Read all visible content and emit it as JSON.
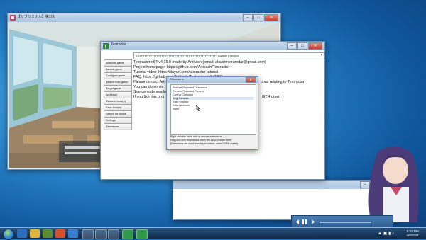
{
  "game_window": {
    "title": "[【サブリミナル】第1話]"
  },
  "textractor": {
    "title": "Textractor",
    "process_select": "0:0-FFFFFFFFFFFFFFFF:FFFFFFFFFFFFFFFF:FFFFFFFFFFFFFFFF) Console (HB0@0)",
    "buttons": [
      "Attach to game",
      "Launch game",
      "Configure game",
      "Detach from game",
      "Forget game",
      "Add hook",
      "Remove hook(s)",
      "Save hook(s)",
      "Search for hooks",
      "Settings",
      "Extensions"
    ],
    "lines": [
      "Textractor x64 v4.16.0 made by Artikash (email: akashmozumdar@gmail.com)",
      "Project homepage: https://github.com/Artikash/Textractor",
      "Tutorial video: https://tinyurl.com/textractor-tutorial",
      "FAQ: https://github.com/Artikash/Textractor/wiki/FAQ",
      "Please contact Arti",
      "You can do so via",
      "Source code availa",
      "If you like this proj"
    ],
    "line_tails": [
      "tions relating to Textractor",
      "GTH down :)"
    ]
  },
  "extensions_dialog": {
    "title": "Extensions",
    "items": [
      "Remove Repeated Characters",
      "Remove Repeated Phrases",
      "Copy to Clipboard",
      "Bing Translate",
      "Extra Window",
      "Extra Newlines",
      "Styler"
    ],
    "help": [
      "Right click the list to add or remove extensions",
      "Drag and drop extensions within the list to reorder them",
      "(Extensions are used from top to bottom: order DOES matter)"
    ]
  },
  "taskbar": {
    "clock_time": "5:52 PM",
    "clock_date": "4/8/2021",
    "tray": "▲ ▣ ▮ ♪"
  },
  "colors": {
    "desktop": "#1d6fb8",
    "titlebar": "#a9c3df",
    "close_button": "#c4412e"
  }
}
